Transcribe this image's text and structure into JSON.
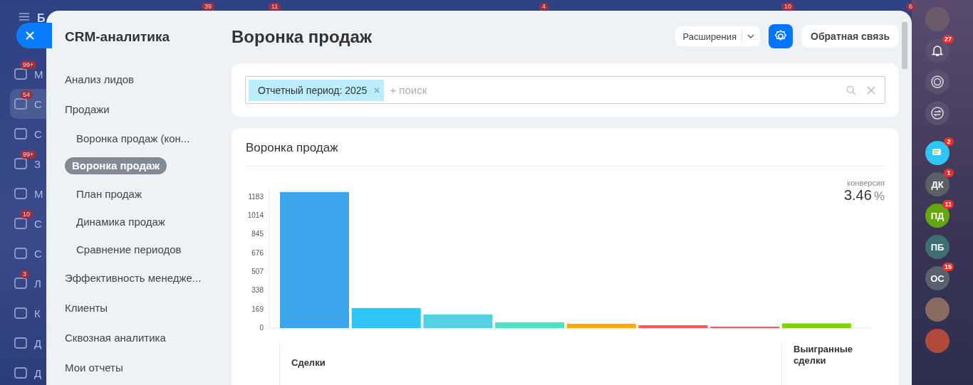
{
  "left_rail": {
    "letter": "Б",
    "items": [
      {
        "letter": "М",
        "badge": "99+",
        "selected": false
      },
      {
        "letter": "С",
        "badge": "54",
        "selected": true
      },
      {
        "letter": "С",
        "selected": false
      },
      {
        "letter": "З",
        "badge": "99+",
        "selected": false
      },
      {
        "letter": "М",
        "selected": false
      },
      {
        "letter": "С",
        "badge": "10",
        "selected": false
      },
      {
        "letter": "С",
        "selected": false
      },
      {
        "letter": "Л",
        "badge": "3",
        "selected": false
      },
      {
        "letter": "К",
        "selected": false
      },
      {
        "letter": "Д",
        "selected": false
      },
      {
        "letter": "Д",
        "selected": false
      }
    ]
  },
  "top_badges": [
    "39",
    "11",
    "4",
    "10",
    "6"
  ],
  "sidebar": {
    "title": "CRM-аналитика",
    "items": [
      {
        "label": "Анализ лидов",
        "selected": false
      },
      {
        "label": "Продажи",
        "selected": false,
        "children": [
          {
            "label": "Воронка продаж (кон...",
            "selected": false
          },
          {
            "label": "Воронка продаж",
            "selected": true
          },
          {
            "label": "План продаж",
            "selected": false
          },
          {
            "label": "Динамика продаж",
            "selected": false
          },
          {
            "label": "Сравнение периодов",
            "selected": false
          }
        ]
      },
      {
        "label": "Эффективность менедже...",
        "selected": false
      },
      {
        "label": "Клиенты",
        "selected": false
      },
      {
        "label": "Сквозная аналитика",
        "selected": false
      },
      {
        "label": "Мои отчеты",
        "selected": false
      }
    ]
  },
  "header": {
    "title": "Воронка продаж",
    "extensions": "Расширения",
    "feedback": "Обратная связь"
  },
  "filter": {
    "tag": "Отчетный период: 2025",
    "placeholder": "+ поиск"
  },
  "report": {
    "title": "Воронка продаж",
    "conversion_label": "конверсия",
    "conversion_value": "3.46",
    "conversion_unit": "%",
    "chart_data": {
      "type": "bar",
      "yticks": [
        0,
        169,
        338,
        507,
        676,
        845,
        1014,
        1183
      ],
      "ylim": [
        0,
        1240
      ],
      "values": [
        1228,
        181,
        123,
        52,
        39,
        26,
        13,
        42
      ],
      "colors": [
        "#3aa4ec",
        "#2fc6f6",
        "#55d0e0",
        "#47e4c2",
        "#ffa900",
        "#ff5752",
        "#ff5752",
        "#7bd500"
      ]
    },
    "groups": [
      "Сделки",
      "Выигранные сделки"
    ]
  },
  "right_rail": {
    "items": [
      {
        "kind": "photo",
        "color": "#6a5a6a"
      },
      {
        "kind": "bell",
        "badge": "27",
        "color": "#5a5070"
      },
      {
        "kind": "target",
        "color": "#5a5070"
      },
      {
        "kind": "swap",
        "color": "#5a5070"
      },
      {
        "kind": "chat",
        "badge": "2",
        "color": "#2fc6f6"
      },
      {
        "kind": "initials",
        "badge": "1",
        "initials": "ДК",
        "color": "#5c5f66"
      },
      {
        "kind": "initials",
        "badge": "11",
        "initials": "ПД",
        "color": "#63a60f"
      },
      {
        "kind": "initials",
        "initials": "ПБ",
        "color": "#3e6f72"
      },
      {
        "kind": "initials",
        "badge": "15",
        "initials": "ОС",
        "color": "#59626c"
      },
      {
        "kind": "photo",
        "color": "#8a6a60"
      },
      {
        "kind": "photo",
        "color": "#b04a3a"
      }
    ]
  }
}
